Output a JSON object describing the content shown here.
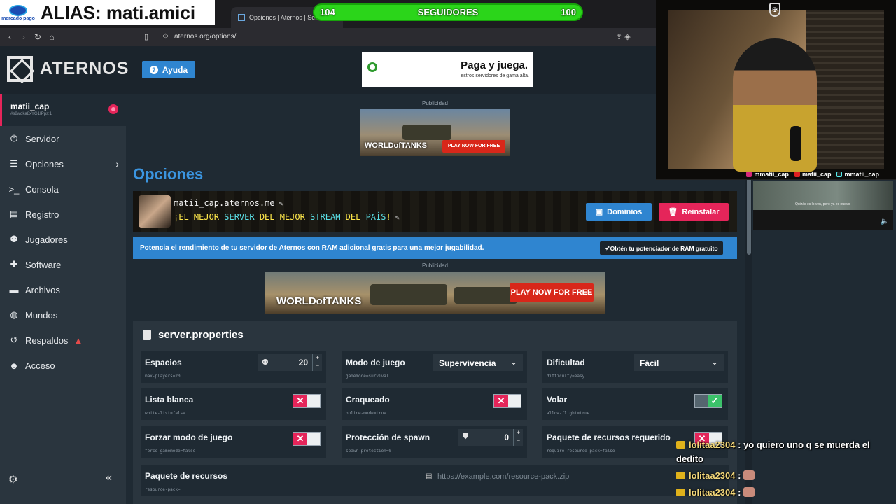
{
  "browser": {
    "tab_title": "Opciones | Aternos | Servid",
    "url": "aternos.org/options/"
  },
  "overlays": {
    "mp_logo_text": "mercado pago",
    "alias": "ALIAS: mati.amici",
    "follow_left": "104",
    "follow_label": "SEGUIDORES",
    "follow_right": "100",
    "socials": [
      "mmatii_cap",
      "matii_cap",
      "mmatii_cap"
    ],
    "minivid_caption": "Quizás es lo ven, pero ya es nuevo"
  },
  "header": {
    "logo_text": "ATERNOS",
    "help_label": "Ayuda",
    "top_ad_big": "Paga y juega.",
    "top_ad_small": "estros servidores de gama alta."
  },
  "user": {
    "name": "matii_cap",
    "id": "#s8wqka8xYG1IPps:1"
  },
  "sidebar": {
    "items": [
      {
        "label": "Servidor",
        "icon": "power-icon"
      },
      {
        "label": "Opciones",
        "icon": "sliders-icon"
      },
      {
        "label": "Consola",
        "icon": "terminal-icon"
      },
      {
        "label": "Registro",
        "icon": "file-icon"
      },
      {
        "label": "Jugadores",
        "icon": "users-icon"
      },
      {
        "label": "Software",
        "icon": "puzzle-icon"
      },
      {
        "label": "Archivos",
        "icon": "folder-icon"
      },
      {
        "label": "Mundos",
        "icon": "globe-icon"
      },
      {
        "label": "Respaldos",
        "icon": "history-icon"
      },
      {
        "label": "Acceso",
        "icon": "user-gear-icon"
      }
    ]
  },
  "ads": {
    "label": "Publicidad",
    "wot_logo": "WORLDofTANKS",
    "wot_cta_small": "PLAY NOW FOR FREE",
    "wot_cta_big": "PLAY NOW FOR FREE"
  },
  "main": {
    "title": "Opciones",
    "server_address": "matii_cap.aternos.me",
    "motd_parts": [
      "¡EL MEJOR ",
      "SERVER",
      " DEL MEJOR ",
      "STREAM",
      " DEL ",
      "PAÍS",
      "!"
    ],
    "domains_label": "Dominios",
    "reset_label": "Reinstalar",
    "promo_text": "Potencia el rendimiento de tu servidor de Aternos con RAM adicional gratis para una mejor jugabilidad.",
    "promo_button": "Obtén tu potenciador de RAM gratuito"
  },
  "properties": {
    "title": "server.properties",
    "slots": {
      "label": "Espacios",
      "key": "max-players=20",
      "value": "20"
    },
    "gamemode": {
      "label": "Modo de juego",
      "key": "gamemode=survival",
      "value": "Supervivencia"
    },
    "difficulty": {
      "label": "Dificultad",
      "key": "difficulty=easy",
      "value": "Fácil"
    },
    "whitelist": {
      "label": "Lista blanca",
      "key": "white-list=false",
      "state": false
    },
    "cracked": {
      "label": "Craqueado",
      "key": "online-mode=true",
      "state": false
    },
    "flight": {
      "label": "Volar",
      "key": "allow-flight=true",
      "state": true
    },
    "force_gamemode": {
      "label": "Forzar modo de juego",
      "key": "force-gamemode=false",
      "state": false
    },
    "spawn_protection": {
      "label": "Protección de spawn",
      "key": "spawn-protection=0",
      "value": "0"
    },
    "resource_pack_required": {
      "label": "Paquete de recursos requerido",
      "key": "require-resource-pack=false",
      "state": false
    },
    "resource_pack": {
      "label": "Paquete de recursos",
      "key": "resource-pack=",
      "placeholder": "https://example.com/resource-pack.zip"
    }
  },
  "chat": [
    {
      "user": "lolitaa2304",
      "text": ": yo quiero uno q se muerda el dedito"
    },
    {
      "user": "lolitaa2304",
      "text": ":"
    },
    {
      "user": "lolitaa2304",
      "text": ":"
    }
  ],
  "colors": {
    "brand_blue": "#2f85d0",
    "accent_pink": "#e5255a",
    "success_green": "#3bc26a",
    "title_blue": "#3b95e0"
  }
}
